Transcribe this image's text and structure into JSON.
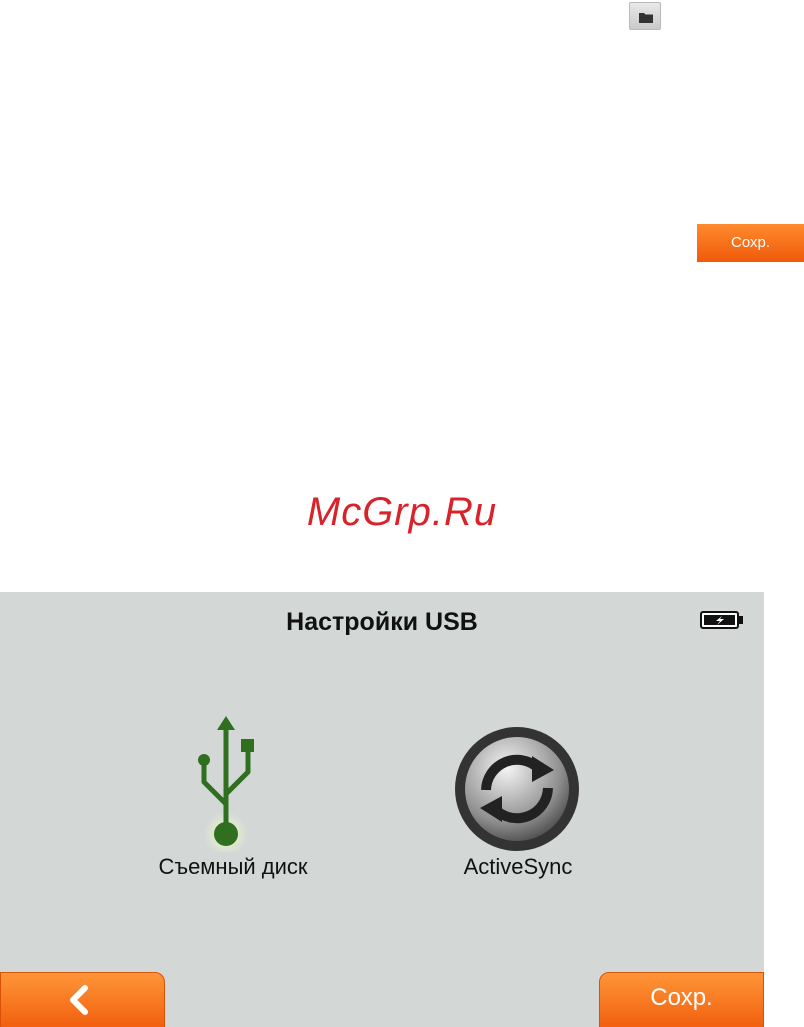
{
  "manual": {
    "folder_icon": "folder-icon",
    "save_label": "Сохр.",
    "watermark": "McGrp.Ru"
  },
  "screen": {
    "title": "Настройки USB",
    "battery_icon": "battery-charging-icon",
    "options": [
      {
        "label": "Съемный диск",
        "icon": "usb-icon"
      },
      {
        "label": "ActiveSync",
        "icon": "sync-icon"
      }
    ],
    "back_icon": "chevron-left-icon",
    "save_label": "Сохр."
  },
  "colors": {
    "accent": "#f26b1d",
    "usb_green": "#2f6f1f",
    "screen_bg": "#d3d8d7",
    "watermark": "#d9232b"
  }
}
